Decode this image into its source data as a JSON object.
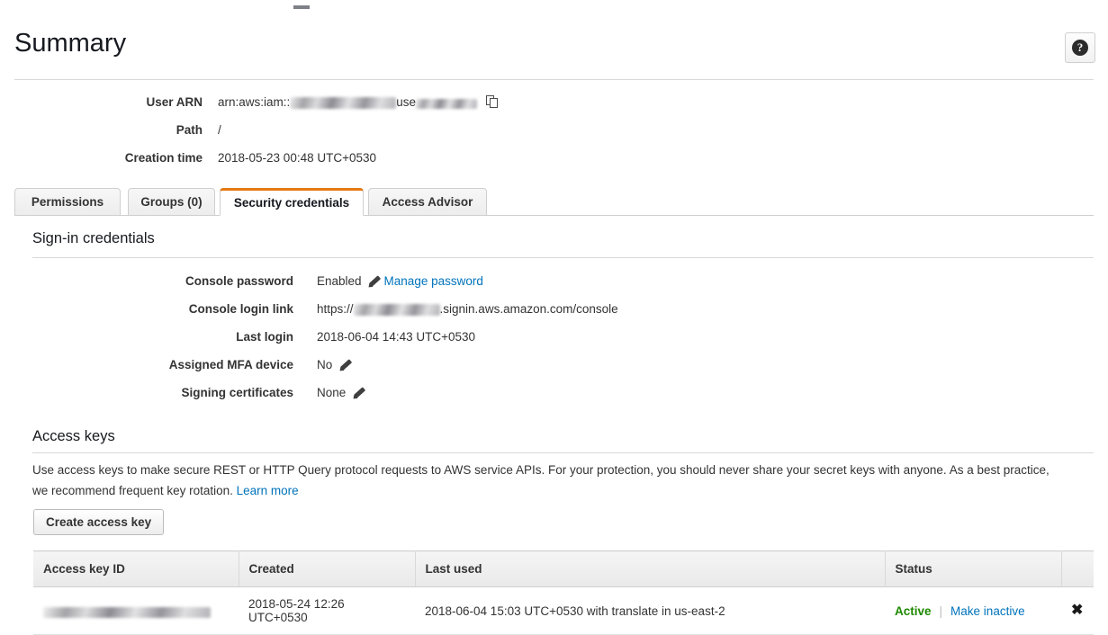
{
  "header": {
    "title": "Summary",
    "help_icon": "question-mark-icon",
    "help_label": "?"
  },
  "summary": {
    "rows": [
      {
        "label": "User ARN",
        "value_prefix": "arn:aws:iam::",
        "value_mid": "use",
        "redacted": true,
        "has_copy": true
      },
      {
        "label": "Path",
        "value": "/"
      },
      {
        "label": "Creation time",
        "value": "2018-05-23 00:48 UTC+0530"
      }
    ]
  },
  "tabs": [
    {
      "label": "Permissions",
      "active": false
    },
    {
      "label": "Groups (0)",
      "active": false
    },
    {
      "label": "Security credentials",
      "active": true
    },
    {
      "label": "Access Advisor",
      "active": false
    }
  ],
  "signin_section": {
    "heading": "Sign-in credentials",
    "rows": [
      {
        "label": "Console password",
        "value": "Enabled",
        "edit_icon": "pencil-icon",
        "link": "Manage password"
      },
      {
        "label": "Console login link",
        "value_prefix": "https://",
        "value_suffix": ".signin.aws.amazon.com/console",
        "redacted": true
      },
      {
        "label": "Last login",
        "value": "2018-06-04 14:43 UTC+0530"
      },
      {
        "label": "Assigned MFA device",
        "value": "No",
        "edit_icon": "pencil-icon"
      },
      {
        "label": "Signing certificates",
        "value": "None",
        "edit_icon": "pencil-icon"
      }
    ]
  },
  "access_keys_section": {
    "heading": "Access keys",
    "description": "Use access keys to make secure REST or HTTP Query protocol requests to AWS service APIs. For your protection, you should never share your secret keys with anyone. As a best practice, we recommend frequent key rotation.",
    "learn_more": "Learn more",
    "create_button": "Create access key",
    "table": {
      "columns": [
        "Access key ID",
        "Created",
        "Last used",
        "Status",
        ""
      ],
      "rows": [
        {
          "access_key_id": "",
          "created": "2018-05-24 12:26 UTC+0530",
          "last_used": "2018-06-04 15:03 UTC+0530 with translate in us-east-2",
          "status": "Active",
          "status_separator": "|",
          "status_action": "Make inactive",
          "delete_icon": "close-x-icon",
          "delete_label": "✖"
        }
      ]
    }
  },
  "colors": {
    "accent_orange": "#e47911",
    "link_blue": "#0073bb",
    "status_green": "#1e8900",
    "text": "#333333"
  }
}
